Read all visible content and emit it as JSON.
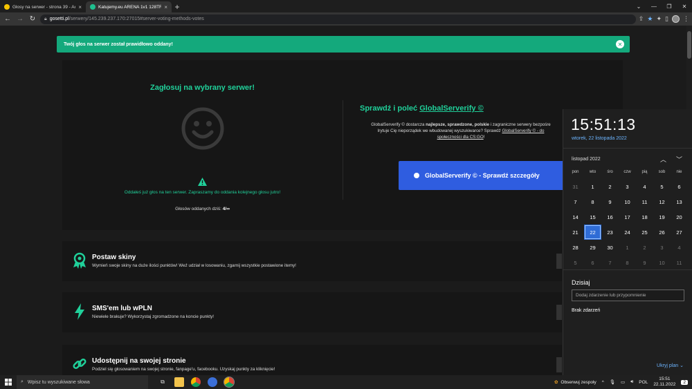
{
  "browser": {
    "tabs": [
      {
        "title": "Głosy na serwer - strona 39 - Acti",
        "active": false,
        "favicon_color": "#f5c400"
      },
      {
        "title": "Katujemy.eu ARENA 1v1 128TR",
        "active": true,
        "favicon_color": "#1fbf8f"
      }
    ],
    "new_tab": "+",
    "url_host": "gosetti.pl",
    "url_path": "/serwery/145.239.237.170:27015#server-voting-methods-votes"
  },
  "toast": {
    "message": "Twój głos na serwer został prawidłowo oddany!",
    "close": "✕"
  },
  "vote": {
    "title": "Zagłosuj na wybrany serwer!",
    "already_voted": "Oddałeś już głos na ten serwer. Zapraszamy do oddania kolejnego głosu jutro!",
    "votes_label": "Głosów oddanych dziś:",
    "votes_value": "4/∞"
  },
  "globalserverify": {
    "title_prefix": "Sprawdź i poleć",
    "title_link": "GlobalServerify ©",
    "desc_1": "GlobalServerify © dostarcza",
    "desc_bold": "najlepsze, sprawdzone, polskie",
    "desc_2": "i zagraniczne serwery bezpośre",
    "desc_3": "Irytuje Cię nieporządek we wbudowanej wyszukiwarce? Sprawdź",
    "desc_link": "GlobalServerify © - do",
    "desc_link2": "społeczności dla CS:GO",
    "desc_end": "!",
    "button": "GlobalServerify © - Sprawdź szczegóły"
  },
  "features": [
    {
      "title": "Postaw skiny",
      "desc": "Wymień swoje skiny na duże ilości punktów! Weź udział w losowaniu, zgarnij wszystkie postawione itemy!",
      "icon": "award-icon"
    },
    {
      "title": "SMS'em lub wPLN",
      "desc": "Niewiele brakuje? Wykorzystaj zgromadzone na koncie punkty!",
      "icon": "lightning-icon"
    },
    {
      "title": "Udostępnij na swojej stronie",
      "desc": "Podziel się głosowaniem na swojej stronie, fanpage'u, facebooku. Uzyskaj punkty za kliknięcie!",
      "icon": "link-icon"
    }
  ],
  "calendar": {
    "time": "15:51:13",
    "date": "wtorek, 22 listopada 2022",
    "month": "listopad 2022",
    "days_of_week": [
      "pon",
      "wto",
      "śro",
      "czw",
      "pią",
      "sob",
      "nie"
    ],
    "weeks": [
      [
        {
          "d": "31",
          "dim": true
        },
        {
          "d": "1"
        },
        {
          "d": "2"
        },
        {
          "d": "3"
        },
        {
          "d": "4"
        },
        {
          "d": "5"
        },
        {
          "d": "6"
        }
      ],
      [
        {
          "d": "7"
        },
        {
          "d": "8"
        },
        {
          "d": "9"
        },
        {
          "d": "10"
        },
        {
          "d": "11"
        },
        {
          "d": "12"
        },
        {
          "d": "13"
        }
      ],
      [
        {
          "d": "14"
        },
        {
          "d": "15"
        },
        {
          "d": "16"
        },
        {
          "d": "17"
        },
        {
          "d": "18"
        },
        {
          "d": "19"
        },
        {
          "d": "20"
        }
      ],
      [
        {
          "d": "21"
        },
        {
          "d": "22",
          "today": true
        },
        {
          "d": "23"
        },
        {
          "d": "24"
        },
        {
          "d": "25"
        },
        {
          "d": "26"
        },
        {
          "d": "27"
        }
      ],
      [
        {
          "d": "28"
        },
        {
          "d": "29"
        },
        {
          "d": "30"
        },
        {
          "d": "1",
          "dim": true
        },
        {
          "d": "2",
          "dim": true
        },
        {
          "d": "3",
          "dim": true
        },
        {
          "d": "4",
          "dim": true
        }
      ],
      [
        {
          "d": "5",
          "dim": true
        },
        {
          "d": "6",
          "dim": true
        },
        {
          "d": "7",
          "dim": true
        },
        {
          "d": "8",
          "dim": true
        },
        {
          "d": "9",
          "dim": true
        },
        {
          "d": "10",
          "dim": true
        },
        {
          "d": "11",
          "dim": true
        }
      ]
    ],
    "today_label": "Dzisiaj",
    "event_placeholder": "Dodaj zdarzenie lub przypomnienie",
    "no_events": "Brak zdarzeń",
    "hide_plan": "Ukryj plan"
  },
  "taskbar": {
    "search_placeholder": "Wpisz tu wyszukiwane słowa",
    "meet": "Obserwuj zespoły",
    "lang": "POL",
    "time": "15:51",
    "date": "22.11.2022",
    "notifications": "2"
  },
  "colors": {
    "accent_green": "#20d09a",
    "toast_green": "#14a97c",
    "button_blue": "#2f5de0",
    "today_blue": "#2f6cd6"
  }
}
